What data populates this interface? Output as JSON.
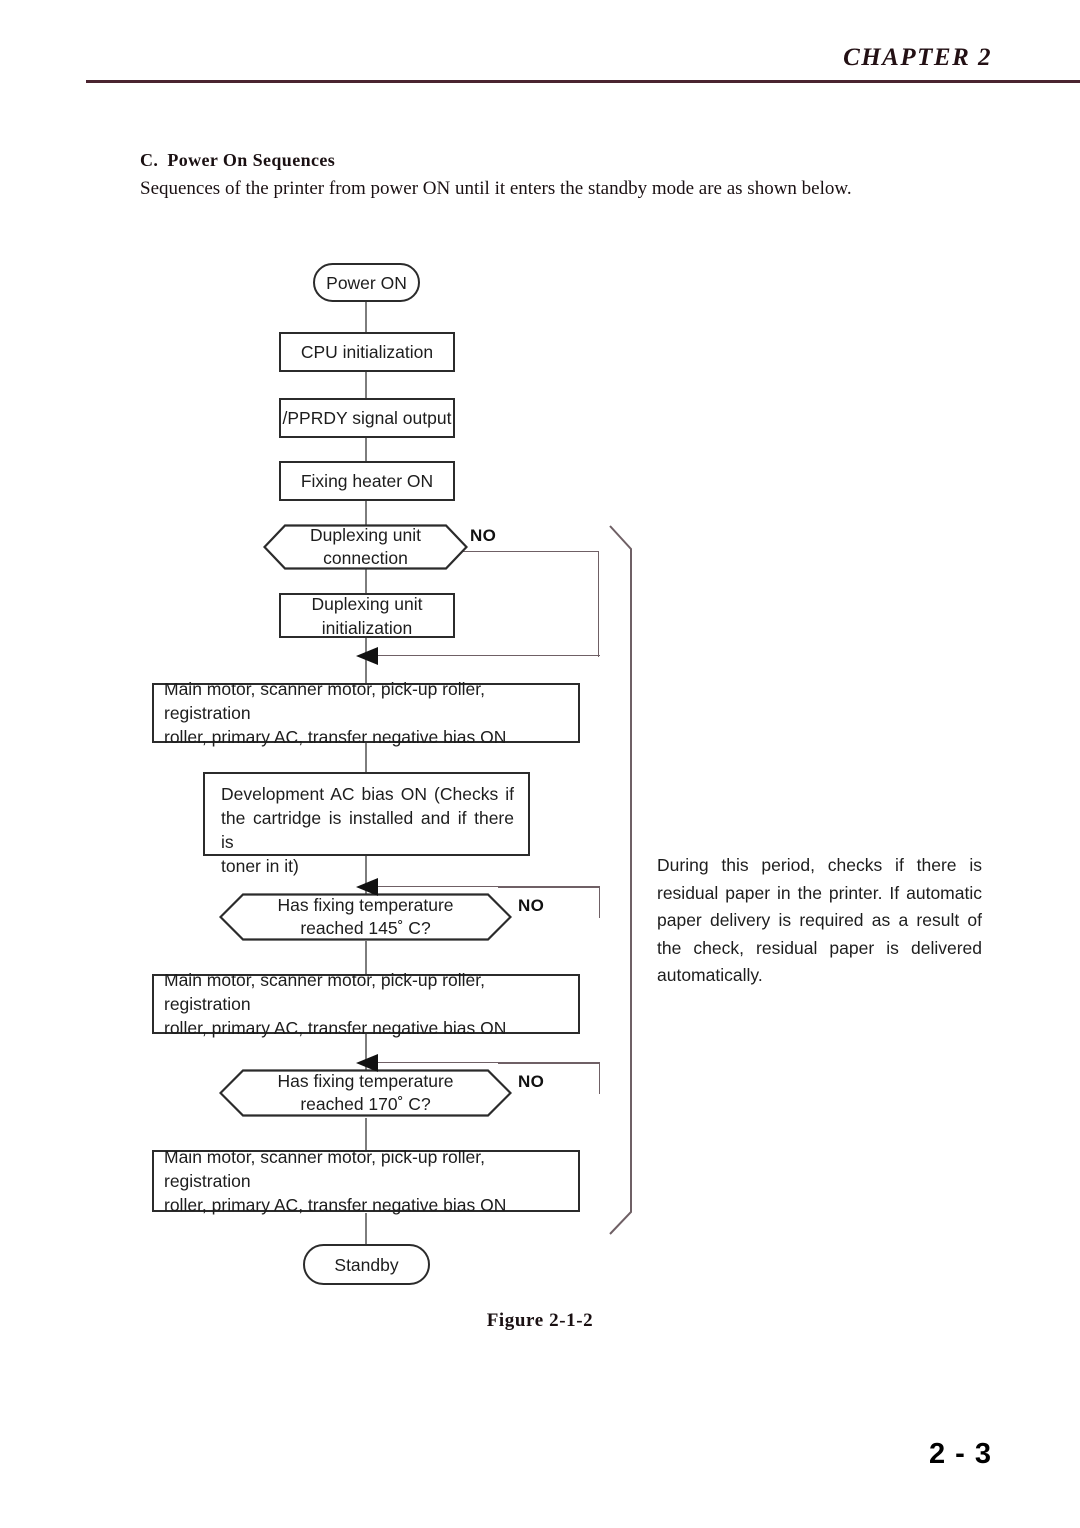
{
  "header": {
    "chapter": "CHAPTER 2",
    "rule_color": "#4a2430"
  },
  "section": {
    "heading_letter": "C.",
    "heading_title": "Power On Sequences",
    "intro": "Sequences of the printer from power ON until it enters the standby mode are as shown below."
  },
  "flowchart": {
    "nodes": [
      {
        "id": "power-on",
        "type": "terminator",
        "label": "Power ON"
      },
      {
        "id": "cpu-initialization",
        "type": "process",
        "label": "CPU initialization"
      },
      {
        "id": "pprdy-signal-output",
        "type": "process",
        "label": "/PPRDY signal output"
      },
      {
        "id": "fixing-heater-on",
        "type": "process",
        "label": "Fixing heater ON"
      },
      {
        "id": "duplexing-unit-connection",
        "type": "decision",
        "label_line1": "Duplexing unit",
        "label_line2": "connection",
        "branch_label": "NO"
      },
      {
        "id": "duplexing-unit-initialization",
        "type": "process",
        "label_line1": "Duplexing unit",
        "label_line2": "initialization"
      },
      {
        "id": "motors-on-1",
        "type": "process",
        "label_line1": "Main motor, scanner motor, pick-up roller, registration",
        "label_line2": "roller, primary AC, transfer negative bias ON"
      },
      {
        "id": "development-ac-bias-on",
        "type": "process",
        "label_line1": "Development AC bias ON (Checks if",
        "label_line2": "the cartridge is installed and if there is",
        "label_line3": "toner in it)"
      },
      {
        "id": "fixing-temp-145",
        "type": "decision",
        "label_line1": "Has fixing temperature",
        "label_line2": "reached 145˚ C?",
        "branch_label": "NO"
      },
      {
        "id": "motors-on-2",
        "type": "process",
        "label_line1": "Main motor, scanner motor, pick-up roller, registration",
        "label_line2": "roller, primary AC, transfer negative bias ON"
      },
      {
        "id": "fixing-temp-170",
        "type": "decision",
        "label_line1": "Has fixing temperature",
        "label_line2": "reached 170˚ C?",
        "branch_label": "NO"
      },
      {
        "id": "motors-on-3",
        "type": "process",
        "label_line1": "Main motor, scanner motor, pick-up roller, registration",
        "label_line2": "roller, primary AC, transfer negative bias ON"
      },
      {
        "id": "standby",
        "type": "terminator",
        "label": "Standby"
      }
    ]
  },
  "annotation": {
    "line1": "During this period, checks if there is",
    "line2": "residual paper in the printer.  If automatic",
    "line3": "paper delivery is required as a result of",
    "line4": "the check, residual paper is delivered",
    "line5": "automatically."
  },
  "figure": {
    "caption": "Figure 2-1-2"
  },
  "footer": {
    "page_number": "2 - 3"
  }
}
